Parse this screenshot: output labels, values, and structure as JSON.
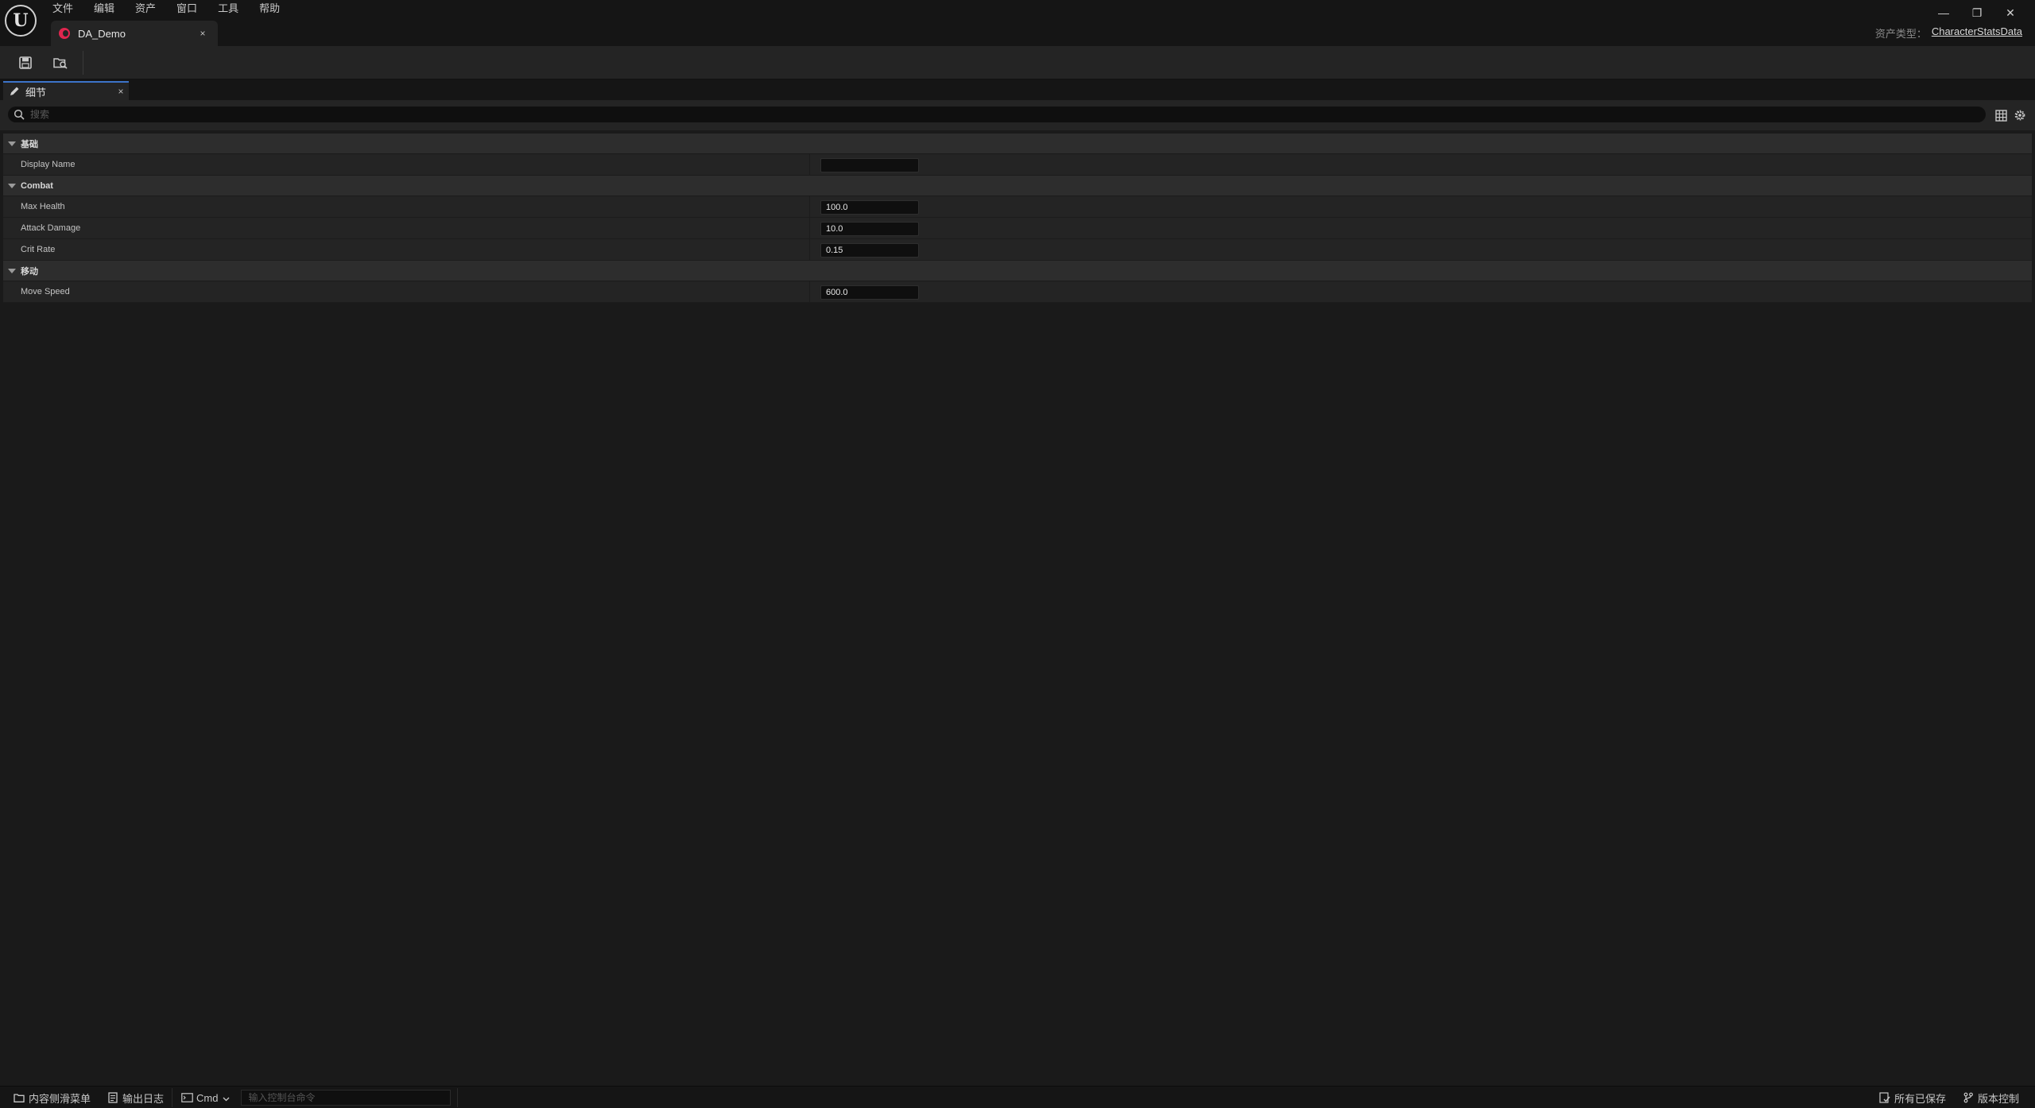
{
  "menu": {
    "items": [
      "文件",
      "编辑",
      "资产",
      "窗口",
      "工具",
      "帮助"
    ]
  },
  "logo_text": "U",
  "document_tab": {
    "label": "DA_Demo",
    "close": "×"
  },
  "window_controls": {
    "minimize": "—",
    "restore": "❐",
    "close": "✕"
  },
  "asset_type": {
    "label": "资产类型：",
    "value": "CharacterStatsData"
  },
  "toolbar": {
    "save_icon": "save-icon",
    "browse_icon": "browse-to-asset-icon"
  },
  "details_tab": {
    "label": "细节",
    "close": "×"
  },
  "search": {
    "placeholder": "搜索",
    "value": ""
  },
  "categories": [
    {
      "label": "基础",
      "properties": [
        {
          "name": "Display Name",
          "value": ""
        }
      ]
    },
    {
      "label": "Combat",
      "properties": [
        {
          "name": "Max Health",
          "value": "100.0"
        },
        {
          "name": "Attack Damage",
          "value": "10.0"
        },
        {
          "name": "Crit Rate",
          "value": "0.15"
        }
      ]
    },
    {
      "label": "移动",
      "properties": [
        {
          "name": "Move Speed",
          "value": "600.0"
        }
      ]
    }
  ],
  "statusbar": {
    "content_drawer": "内容侧滑菜单",
    "output_log": "输出日志",
    "cmd_label": "Cmd",
    "console_placeholder": "输入控制台命令",
    "all_saved": "所有已保存",
    "source_control": "版本控制"
  },
  "colors": {
    "accent": "#3d74c9",
    "asset_icon": "#e0264f"
  }
}
